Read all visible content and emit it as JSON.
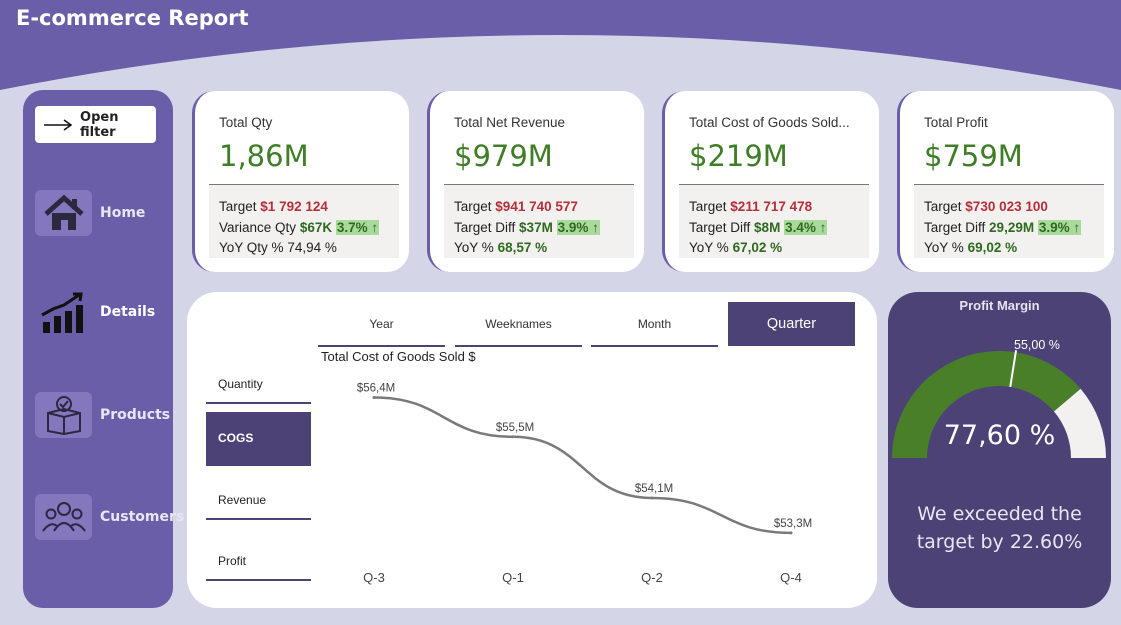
{
  "header": {
    "title": "E-commerce Report"
  },
  "sidebar": {
    "open_filter": "Open filter",
    "items": [
      {
        "label": "Home",
        "icon": "home-icon"
      },
      {
        "label": "Details",
        "icon": "bar-chart-icon"
      },
      {
        "label": "Products",
        "icon": "product-box-icon"
      },
      {
        "label": "Customers",
        "icon": "customers-icon"
      }
    ]
  },
  "kpis": [
    {
      "title": "Total Qty",
      "value": "1,86M",
      "l1_label": "Target",
      "l1_value": "$1 792 124",
      "l2_label": "Variance Qty",
      "l2_value": "$67K",
      "l2_pct": "3.7%",
      "l3_label": "YoY Qty %",
      "l3_value": "74,94 %"
    },
    {
      "title": "Total Net Revenue",
      "value": "$979M",
      "l1_label": "Target",
      "l1_value": "$941 740 577",
      "l2_label": "Target Diff",
      "l2_value": "$37M",
      "l2_pct": "3.9%",
      "l3_label": "YoY %",
      "l3_value": "68,57 %"
    },
    {
      "title": "Total Cost of Goods Sold...",
      "value": "$219M",
      "l1_label": "Target",
      "l1_value": "$211 717 478",
      "l2_label": "Target Diff",
      "l2_value": "$8M",
      "l2_pct": "3.4%",
      "l3_label": "YoY %",
      "l3_value": "67,02 %"
    },
    {
      "title": "Total Profit",
      "value": "$759M",
      "l1_label": "Target",
      "l1_value": "$730 023 100",
      "l2_label": "Target Diff",
      "l2_value": "29,29M",
      "l2_pct": "3.9%",
      "l3_label": "YoY %",
      "l3_value": "69,02 %"
    }
  ],
  "tabs": {
    "top": [
      "Year",
      "Weeknames",
      "Month",
      "Quarter"
    ],
    "top_active": "Quarter",
    "side": [
      "Quantity",
      "COGS",
      "Revenue",
      "Profit"
    ],
    "side_active": "COGS"
  },
  "chart_data": {
    "type": "line",
    "title": "Total Cost of Goods Sold $",
    "categories": [
      "Q-3",
      "Q-1",
      "Q-2",
      "Q-4"
    ],
    "values": [
      56.4,
      55.5,
      54.1,
      53.3
    ],
    "labels": [
      "$56,4M",
      "$55,5M",
      "$54,1M",
      "$53,3M"
    ],
    "ylim": [
      53.0,
      56.8
    ],
    "grid": false,
    "line_color": "#7a7a7a"
  },
  "gauge": {
    "title": "Profit Margin",
    "value_label": "77,60 %",
    "value": 77.6,
    "target_label": "55,00 %",
    "target": 55,
    "max": 100,
    "message": "We exceeded the target by 22.60%",
    "fill_color": "#4a7f2a",
    "track_color": "#f2f1ef"
  },
  "colors": {
    "accent": "#6b5ea8",
    "dark_accent": "#4c4275",
    "positive": "#3f7d26",
    "negative": "#b72e3b"
  }
}
